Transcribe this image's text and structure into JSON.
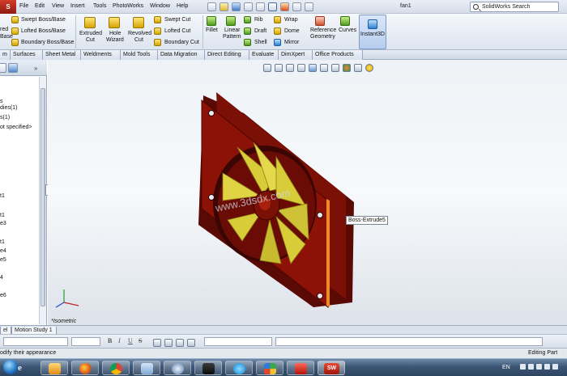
{
  "app": {
    "logo_text": "S",
    "document_title": "fan1",
    "search_label": "SolidWorks Search"
  },
  "menu": [
    "File",
    "Edit",
    "View",
    "Insert",
    "Tools",
    "PhotoWorks",
    "Window",
    "Help"
  ],
  "ribbon": {
    "left_partial": [
      "red",
      "Base"
    ],
    "boss_group": [
      "Swept Boss/Base",
      "Lofted Boss/Base",
      "Boundary Boss/Base"
    ],
    "extruded_cut": [
      "Extruded",
      "Cut"
    ],
    "hole_wizard": [
      "Hole",
      "Wizard"
    ],
    "revolved_cut": [
      "Revolved",
      "Cut"
    ],
    "cut_group": [
      "Swept Cut",
      "Lofted Cut",
      "Boundary Cut"
    ],
    "fillet": "Fillet",
    "linear_pattern": [
      "Linear",
      "Pattern"
    ],
    "features_col1": [
      "Rib",
      "Draft",
      "Shell"
    ],
    "features_col2": [
      "Wrap",
      "Dome",
      "Mirror"
    ],
    "reference_geometry": [
      "Reference",
      "Geometry"
    ],
    "curves": "Curves",
    "instant3d": "Instant3D"
  },
  "tabs": [
    "m",
    "Surfaces",
    "Sheet Metal",
    "Weldments",
    "Mold Tools",
    "Data Migration",
    "Direct Editing",
    "Evaluate",
    "DimXpert",
    "Office Products"
  ],
  "tree": {
    "items": [
      "s",
      "dies(1)",
      "s(1)",
      "ot specified>",
      "t1",
      "t1",
      "e3",
      "t1",
      "e4",
      "e5",
      "4",
      "e6"
    ]
  },
  "viewport": {
    "tooltip": "Boss-Extrude5",
    "watermark": "www.3dsdx.com",
    "view_label": "*Isometric"
  },
  "bottom_tabs": [
    "el",
    "Motion Study 1"
  ],
  "format_bar": {
    "bold": "B",
    "italic": "I",
    "underline": "U",
    "strike": "S"
  },
  "status": {
    "left": "odify their appearance",
    "right": "Editing Part"
  },
  "taskbar": {
    "language": "EN",
    "sw_badge": "SW"
  },
  "colors": {
    "fan_frame": "#8c1208",
    "fan_blades": "#d8cc38",
    "edge_highlight": "#f08a1c",
    "taskbar": "#2d4460"
  }
}
